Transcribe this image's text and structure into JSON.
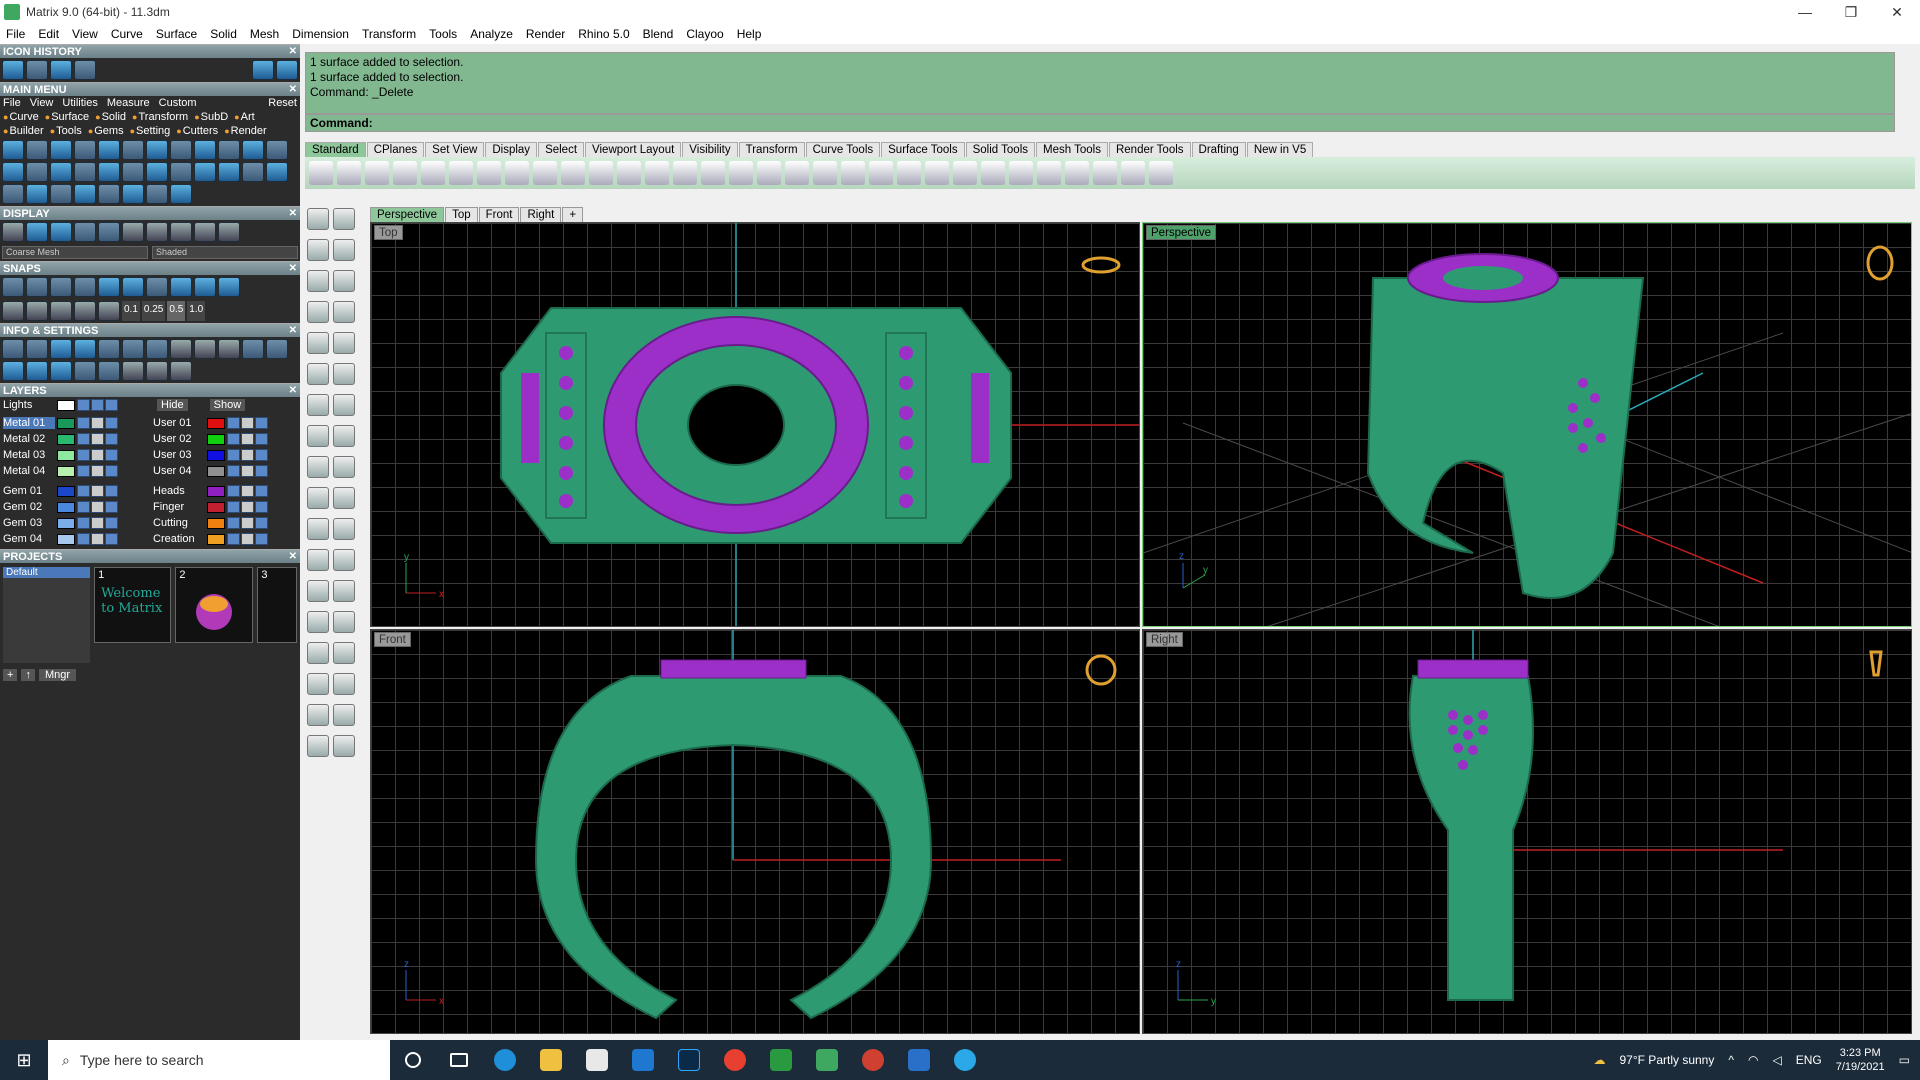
{
  "window": {
    "title": "Matrix 9.0 (64-bit) - 11.3dm",
    "minimize": "—",
    "maximize": "❐",
    "close": "✕"
  },
  "menubar": [
    "File",
    "Edit",
    "View",
    "Curve",
    "Surface",
    "Solid",
    "Mesh",
    "Dimension",
    "Transform",
    "Tools",
    "Analyze",
    "Render",
    "Rhino 5.0",
    "Blend",
    "Clayoo",
    "Help"
  ],
  "panels": {
    "icon_history": "ICON HISTORY",
    "main_menu": "MAIN MENU",
    "display": "DISPLAY",
    "snaps": "SNAPS",
    "info_settings": "INFO & SETTINGS",
    "layers": "LAYERS",
    "projects": "PROJECTS"
  },
  "main_menu": {
    "items": [
      "File",
      "View",
      "Utilities",
      "Measure",
      "Custom"
    ],
    "reset": "Reset",
    "cat_row1": [
      "Curve",
      "Surface",
      "Solid",
      "Transform",
      "SubD",
      "Art"
    ],
    "cat_row2": [
      "Builder",
      "Tools",
      "Gems",
      "Setting",
      "Cutters",
      "Render"
    ]
  },
  "display": {
    "mesh": "Coarse Mesh",
    "mode": "Shaded"
  },
  "snaps": {
    "values": [
      "0.1",
      "0.25",
      "0.5",
      "1.0"
    ]
  },
  "layers": {
    "lights": "Lights",
    "hide": "Hide",
    "show": "Show",
    "left": [
      {
        "name": "Metal 01",
        "color": "#1a9a5a",
        "selected": true
      },
      {
        "name": "Metal 02",
        "color": "#2ab870"
      },
      {
        "name": "Metal 03",
        "color": "#8ee8a0"
      },
      {
        "name": "Metal 04",
        "color": "#b8f0b0"
      },
      {
        "name": "Gem 01",
        "color": "#1a48c8"
      },
      {
        "name": "Gem 02",
        "color": "#4a88e0"
      },
      {
        "name": "Gem 03",
        "color": "#7aaee8"
      },
      {
        "name": "Gem 04",
        "color": "#a8c8f0"
      }
    ],
    "right": [
      {
        "name": "User 01",
        "color": "#e01010"
      },
      {
        "name": "User 02",
        "color": "#10d010"
      },
      {
        "name": "User 03",
        "color": "#1010e0"
      },
      {
        "name": "User 04",
        "color": "#909090"
      },
      {
        "name": "Heads",
        "color": "#9020c0"
      },
      {
        "name": "Finger",
        "color": "#c02030"
      },
      {
        "name": "Cutting",
        "color": "#f08010"
      },
      {
        "name": "Creation",
        "color": "#f0a020"
      }
    ]
  },
  "projects": {
    "default": "Default",
    "thumb1": "1",
    "thumb2": "2",
    "thumb3": "3",
    "welcome": "Welcome to Matrix",
    "mngr": "Mngr"
  },
  "command": {
    "history": [
      "1 surface added to selection.",
      "1 surface added to selection.",
      "Command: _Delete"
    ],
    "prompt": "Command:"
  },
  "toolbar_tabs": [
    "Standard",
    "CPlanes",
    "Set View",
    "Display",
    "Select",
    "Viewport Layout",
    "Visibility",
    "Transform",
    "Curve Tools",
    "Surface Tools",
    "Solid Tools",
    "Mesh Tools",
    "Render Tools",
    "Drafting",
    "New in V5"
  ],
  "viewport_tabs": [
    "Perspective",
    "Top",
    "Front",
    "Right",
    "+"
  ],
  "viewports": {
    "top": "Top",
    "perspective": "Perspective",
    "front": "Front",
    "right": "Right"
  },
  "axes": {
    "x": "x",
    "y": "y",
    "z": "z"
  },
  "taskbar": {
    "search": "Type here to search",
    "weather": "97°F  Partly sunny",
    "lang": "ENG",
    "time": "3:23 PM",
    "date": "7/19/2021"
  },
  "colors": {
    "metal": "#2e9a72",
    "gem": "#9b2fc8",
    "command_bg": "#82b890",
    "grid": "#3a3a3a"
  }
}
